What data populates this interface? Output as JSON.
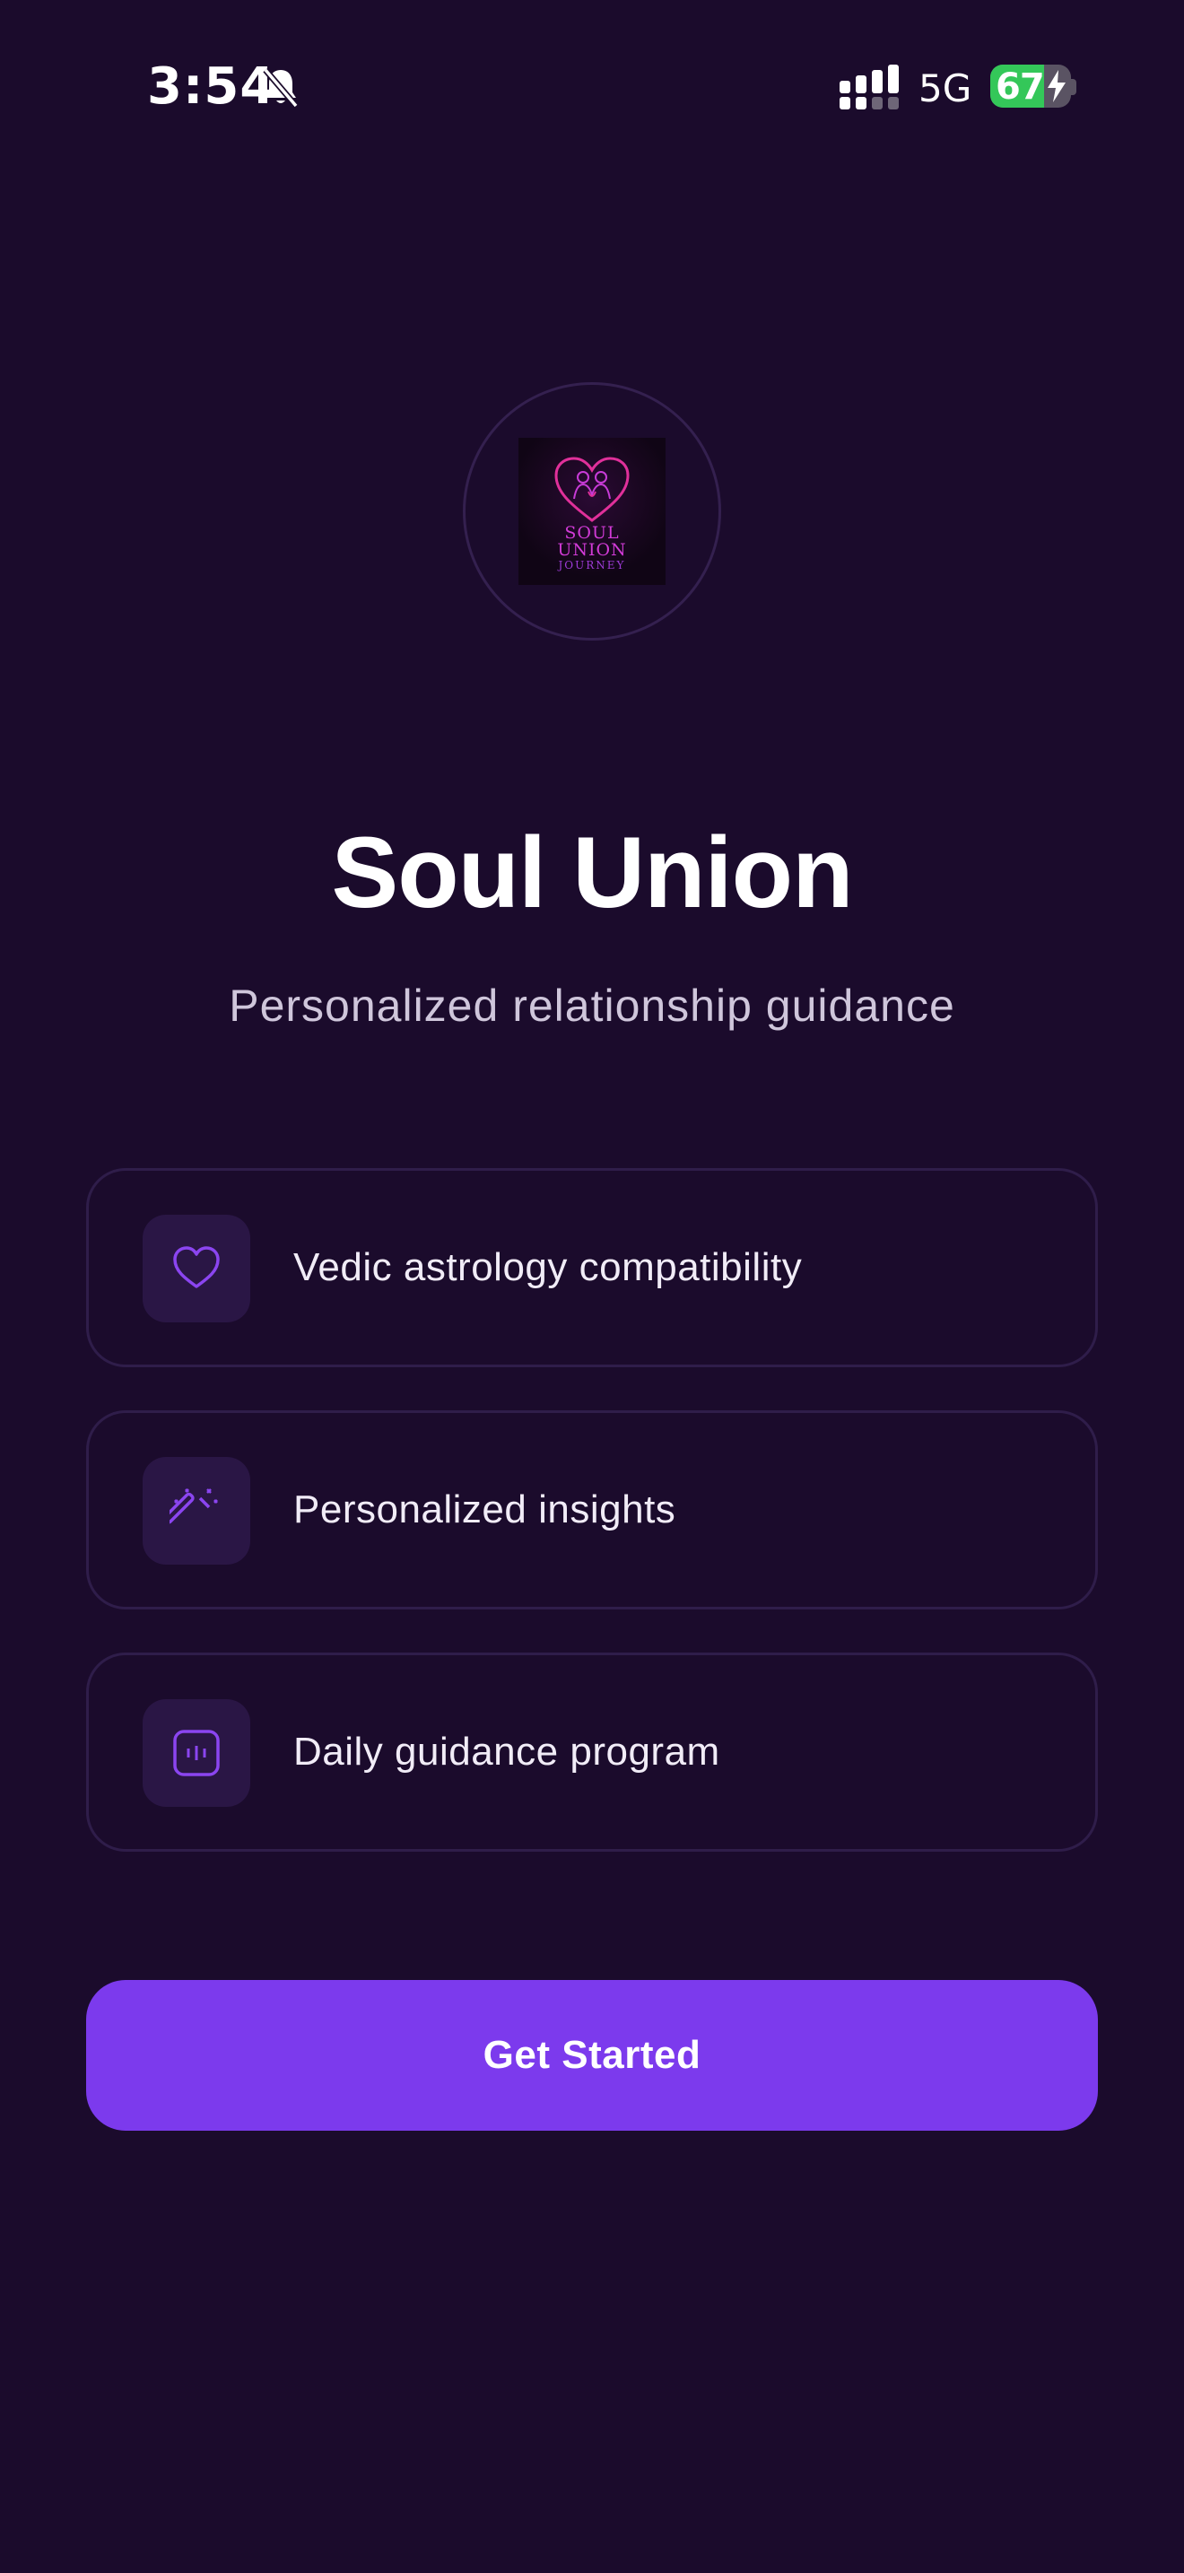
{
  "status_bar": {
    "time": "3:54",
    "network": "5G",
    "battery_percent": "67",
    "battery_level": 0.67,
    "icons": [
      "bell-slash-icon",
      "signal-icon",
      "battery-icon",
      "bolt-icon"
    ]
  },
  "logo": {
    "line1": "SOUL",
    "line2": "UNION",
    "line3": "JOURNEY"
  },
  "header": {
    "title": "Soul Union",
    "subtitle": "Personalized relationship guidance"
  },
  "features": [
    {
      "label": "Vedic astrology compatibility",
      "icon": "heart-icon"
    },
    {
      "label": "Personalized insights",
      "icon": "magic-wand-icon"
    },
    {
      "label": "Daily guidance program",
      "icon": "calendar-icon"
    }
  ],
  "cta": {
    "label": "Get Started"
  },
  "colors": {
    "background": "#1b0b2c",
    "accent": "#7c3aed",
    "icon_accent": "#8b45f0",
    "card_border": "#2f1d4a",
    "battery_green": "#34c759"
  }
}
